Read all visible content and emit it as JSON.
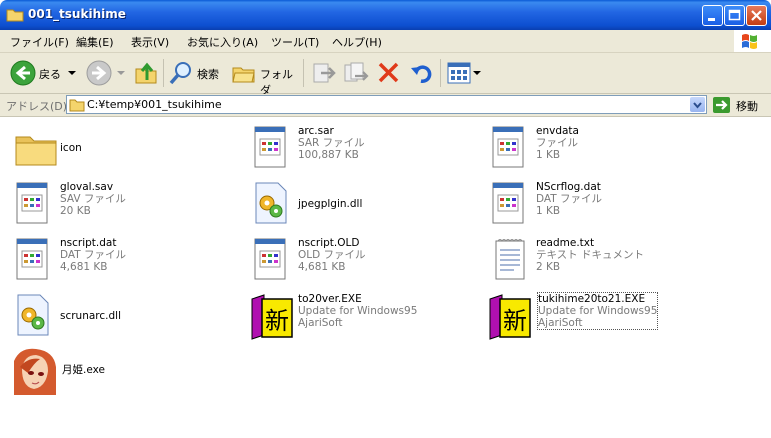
{
  "window": {
    "title": "001_tsukihime"
  },
  "menu": [
    "ファイル(F)",
    "編集(E)",
    "表示(V)",
    "お気に入り(A)",
    "ツール(T)",
    "ヘルプ(H)"
  ],
  "toolbar": {
    "back": "戻る",
    "search": "検索",
    "folders": "フォルダ"
  },
  "address": {
    "label": "アドレス(D)",
    "path": "C:¥temp¥001_tsukihime",
    "go": "移動"
  },
  "files": [
    {
      "name": "icon",
      "type": "",
      "size": "",
      "icon": "folder-icon"
    },
    {
      "name": "arc.sar",
      "type": "SAR ファイル",
      "size": "100,887 KB",
      "icon": "document-icon"
    },
    {
      "name": "envdata",
      "type": "ファイル",
      "size": "1 KB",
      "icon": "document-icon"
    },
    {
      "name": "gloval.sav",
      "type": "SAV ファイル",
      "size": "20 KB",
      "icon": "document-icon"
    },
    {
      "name": "jpegplgin.dll",
      "type": "",
      "size": "",
      "icon": "dll-icon"
    },
    {
      "name": "NScrflog.dat",
      "type": "DAT ファイル",
      "size": "1 KB",
      "icon": "document-icon"
    },
    {
      "name": "nscript.dat",
      "type": "DAT ファイル",
      "size": "4,681 KB",
      "icon": "document-icon"
    },
    {
      "name": "nscript.OLD",
      "type": "OLD ファイル",
      "size": "4,681 KB",
      "icon": "document-icon"
    },
    {
      "name": "readme.txt",
      "type": "テキスト ドキュメント",
      "size": "2 KB",
      "icon": "text-document-icon"
    },
    {
      "name": "scrunarc.dll",
      "type": "",
      "size": "",
      "icon": "dll-icon"
    },
    {
      "name": "to20ver.EXE",
      "type": "Update for Windows95",
      "size": "AjariSoft",
      "icon": "shin-icon"
    },
    {
      "name": "tukihime20to21.EXE",
      "type": "Update for Windows95",
      "size": "AjariSoft",
      "icon": "shin-icon"
    },
    {
      "name": "月姫.exe",
      "type": "",
      "size": "",
      "icon": "character-icon"
    }
  ],
  "colors": {
    "titlebar": "#0a5ad6",
    "chrome": "#ece9d8",
    "shin_yellow": "#f8e900",
    "shin_purple": "#b010b0"
  }
}
